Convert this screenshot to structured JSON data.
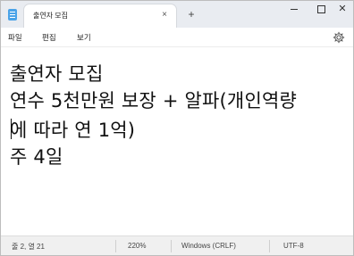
{
  "tab": {
    "title": "출연자 모집",
    "close": "×",
    "add": "+"
  },
  "window": {
    "minimize_label": "",
    "maximize_label": "",
    "close_label": "✕"
  },
  "menu": {
    "file": "파일",
    "edit": "편집",
    "view": "보기"
  },
  "editor": {
    "lines": [
      "출연자 모집",
      "연수 5천만원 보장 + 알파(개인역량",
      "에 따라 연 1억)",
      "주 4일"
    ]
  },
  "status": {
    "position": "줄 2, 열 21",
    "zoom": "220%",
    "line_ending": "Windows (CRLF)",
    "encoding": "UTF-8"
  },
  "icons": {
    "app": "notepad-icon",
    "settings": "gear-icon"
  }
}
